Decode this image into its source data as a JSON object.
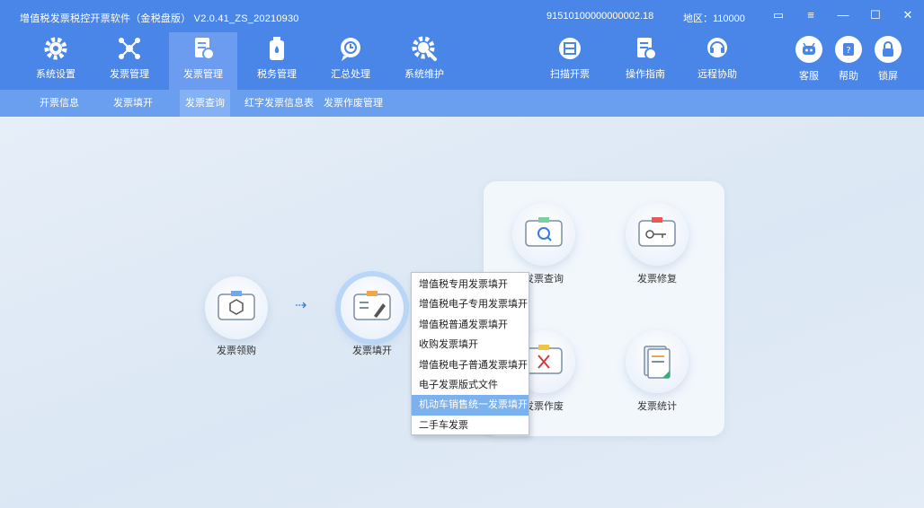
{
  "titlebar": {
    "app_title": "增值税发票税控开票软件（金税盘版） V2.0.41_ZS_20210930",
    "tax_id": "91510100000000002.18",
    "region": "地区：110000"
  },
  "toolbar": {
    "items": [
      {
        "label": "系统设置",
        "icon": "gear-icon"
      },
      {
        "label": "发票管理",
        "icon": "network-icon"
      },
      {
        "label": "发票管理",
        "icon": "invoice-doc-icon"
      },
      {
        "label": "税务管理",
        "icon": "bottle-icon"
      },
      {
        "label": "汇总处理",
        "icon": "chat-clock-icon"
      },
      {
        "label": "系统维护",
        "icon": "wrench-gear-icon"
      },
      {
        "label": "扫描开票",
        "icon": "scan-icon"
      },
      {
        "label": "操作指南",
        "icon": "guide-doc-icon"
      },
      {
        "label": "远程协助",
        "icon": "headset-icon"
      }
    ],
    "right": [
      {
        "label": "客服",
        "icon": "robot-icon"
      },
      {
        "label": "帮助",
        "icon": "help-icon"
      },
      {
        "label": "锁屏",
        "icon": "lock-icon"
      }
    ]
  },
  "subnav": [
    "开票信息",
    "发票填开",
    "发票查询",
    "红字发票信息表",
    "发票作废管理"
  ],
  "flow": {
    "step1": "发票领购",
    "step2": "发票填开",
    "panel": [
      "发票查询",
      "发票修复",
      "发票作废",
      "发票统计"
    ]
  },
  "context_menu": {
    "items": [
      "增值税专用发票填开",
      "增值税电子专用发票填开",
      "增值税普通发票填开",
      "收购发票填开",
      "增值税电子普通发票填开",
      "电子发票版式文件",
      "机动车销售统一发票填开",
      "二手车发票"
    ],
    "highlighted_index": 6
  },
  "colors": {
    "titlebar": "#4a86e8",
    "subnav": "#6a9fef",
    "menu_highlight": "#7bb1ee",
    "accent": "#3a7be0"
  }
}
